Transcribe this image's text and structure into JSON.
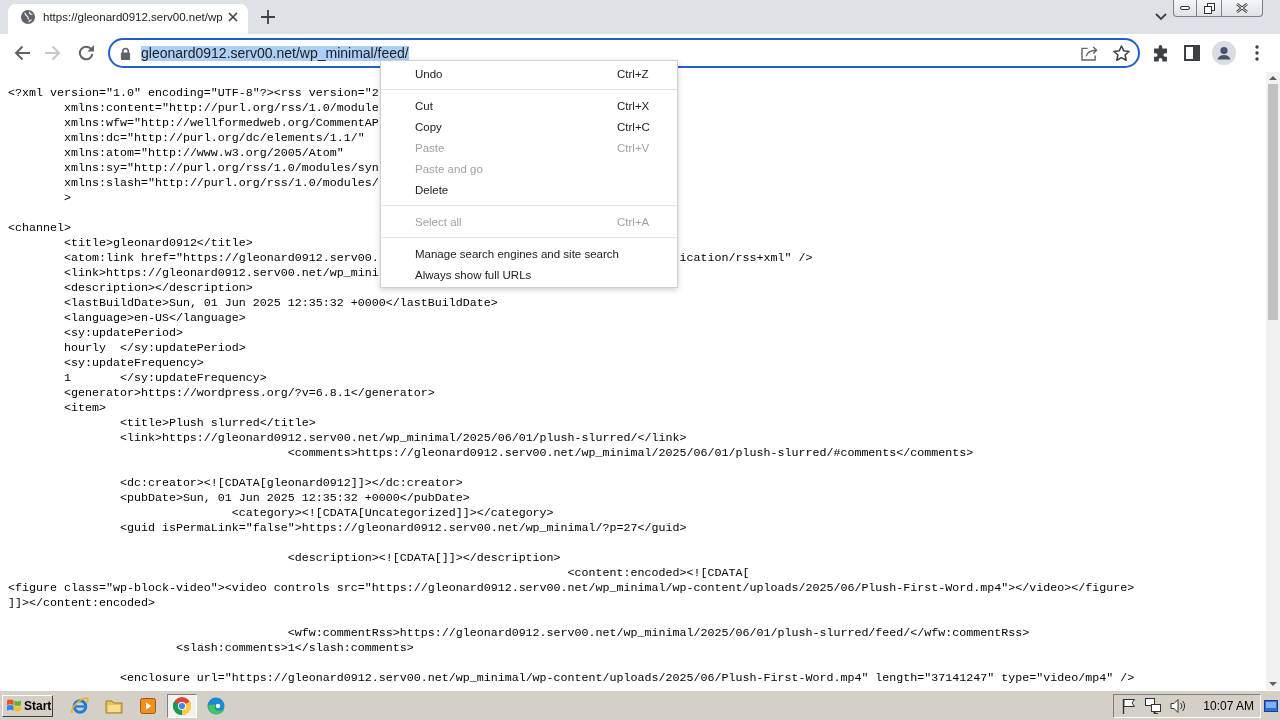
{
  "browser": {
    "tabs": [
      {
        "title": "https://gleonard0912.serv00.net/wp",
        "selected": true
      }
    ],
    "nav_buttons": [
      {
        "kind": "back",
        "disabled": false
      },
      {
        "kind": "forward",
        "disabled": true
      },
      {
        "kind": "reload",
        "disabled": false
      }
    ],
    "address_bar": {
      "url": "gleonard0912.serv00.net/wp_minimal/feed/",
      "selected": true
    }
  },
  "page": {
    "lines": [
      {
        "kind": "code",
        "text": "<?xml version=\"1.0\" encoding=\"UTF-8\"?><rss version=\"2"
      },
      {
        "kind": "code",
        "text": "\txmlns:content=\"http://purl.org/rss/1.0/module"
      },
      {
        "kind": "code",
        "text": "\txmlns:wfw=\"http://wellformedweb.org/CommentAP"
      },
      {
        "kind": "code",
        "text": "\txmlns:dc=\"http://purl.org/dc/elements/1.1/\""
      },
      {
        "kind": "code",
        "text": "\txmlns:atom=\"http://www.w3.org/2005/Atom\""
      },
      {
        "kind": "code",
        "text": "\txmlns:sy=\"http://purl.org/rss/1.0/modules/syn"
      },
      {
        "kind": "code",
        "text": "\txmlns:slash=\"http://purl.org/rss/1.0/modules/"
      },
      {
        "kind": "code",
        "text": "\t>"
      },
      {
        "kind": "blank"
      },
      {
        "kind": "code",
        "text": "<channel>"
      },
      {
        "kind": "code",
        "text": "\t<title>gleonard0912</title>"
      },
      {
        "kind": "code",
        "text": "\t<atom:link href=\"https://gleonard0912.serv00.",
        "text_after_menu": "ication/rss+xml\" />"
      },
      {
        "kind": "code",
        "text": "\t<link>https://gleonard0912.serv00.net/wp_mini"
      },
      {
        "kind": "code",
        "text": "\t<description></description>"
      },
      {
        "kind": "code",
        "text": "\t<lastBuildDate>Sun, 01 Jun 2025 12:35:32 +0000</lastBuildDate>"
      },
      {
        "kind": "code",
        "text": "\t<language>en-US</language>"
      },
      {
        "kind": "code",
        "text": "\t<sy:updatePeriod>"
      },
      {
        "kind": "code",
        "text": "\thourly\t</sy:updatePeriod>"
      },
      {
        "kind": "code",
        "text": "\t<sy:updateFrequency>"
      },
      {
        "kind": "code",
        "text": "\t1\t</sy:updateFrequency>"
      },
      {
        "kind": "code",
        "text": "\t<generator>https://wordpress.org/?v=6.8.1</generator>"
      },
      {
        "kind": "code",
        "text": "\t<item>"
      },
      {
        "kind": "code",
        "text": "\t\t<title>Plush slurred</title>"
      },
      {
        "kind": "code",
        "text": "\t\t<link>https://gleonard0912.serv00.net/wp_minimal/2025/06/01/plush-slurred/</link>"
      },
      {
        "kind": "code",
        "text": "\t\t\t\t\t<comments>https://gleonard0912.serv00.net/wp_minimal/2025/06/01/plush-slurred/#comments</comments>"
      },
      {
        "kind": "blank"
      },
      {
        "kind": "code",
        "text": "\t\t<dc:creator><![CDATA[gleonard0912]]></dc:creator>"
      },
      {
        "kind": "code",
        "text": "\t\t<pubDate>Sun, 01 Jun 2025 12:35:32 +0000</pubDate>"
      },
      {
        "kind": "code",
        "text": "\t\t\t\t<category><![CDATA[Uncategorized]]></category>"
      },
      {
        "kind": "code",
        "text": "\t\t<guid isPermaLink=\"false\">https://gleonard0912.serv00.net/wp_minimal/?p=27</guid>"
      },
      {
        "kind": "blank"
      },
      {
        "kind": "code",
        "text": "\t\t\t\t\t<description><![CDATA[]]></description>"
      },
      {
        "kind": "code",
        "text": "\t\t\t\t\t\t\t\t\t\t<content:encoded><![CDATA["
      },
      {
        "kind": "code",
        "text": "<figure class=\"wp-block-video\"><video controls src=\"https://gleonard0912.serv00.net/wp_minimal/wp-content/uploads/2025/06/Plush-First-Word.mp4\"></video></figure>"
      },
      {
        "kind": "code",
        "text": "]]></content:encoded>"
      },
      {
        "kind": "blank"
      },
      {
        "kind": "code",
        "text": "\t\t\t\t\t<wfw:commentRss>https://gleonard0912.serv00.net/wp_minimal/2025/06/01/plush-slurred/feed/</wfw:commentRss>"
      },
      {
        "kind": "code",
        "text": "\t\t\t<slash:comments>1</slash:comments>"
      },
      {
        "kind": "blank"
      },
      {
        "kind": "code",
        "text": "\t\t<enclosure url=\"https://gleonard0912.serv00.net/wp_minimal/wp-content/uploads/2025/06/Plush-First-Word.mp4\" length=\"37141247\" type=\"video/mp4\" />"
      }
    ]
  },
  "context_menu": {
    "items": [
      {
        "kind": "item",
        "label": "Undo",
        "shortcut": "Ctrl+Z",
        "disabled": false
      },
      {
        "kind": "separator"
      },
      {
        "kind": "item",
        "label": "Cut",
        "shortcut": "Ctrl+X",
        "disabled": false
      },
      {
        "kind": "item",
        "label": "Copy",
        "shortcut": "Ctrl+C",
        "disabled": false
      },
      {
        "kind": "item",
        "label": "Paste",
        "shortcut": "Ctrl+V",
        "disabled": true
      },
      {
        "kind": "item",
        "label": "Paste and go",
        "disabled": true
      },
      {
        "kind": "item",
        "label": "Delete",
        "disabled": false
      },
      {
        "kind": "separator"
      },
      {
        "kind": "item",
        "label": "Select all",
        "shortcut": "Ctrl+A",
        "disabled": true
      },
      {
        "kind": "separator"
      },
      {
        "kind": "item",
        "label": "Manage search engines and site search",
        "disabled": false
      },
      {
        "kind": "item",
        "label": "Always show full URLs",
        "disabled": false
      }
    ]
  },
  "taskbar": {
    "start_label": "Start",
    "apps": [
      {
        "kind": "ie",
        "active": false
      },
      {
        "kind": "folder",
        "active": false
      },
      {
        "kind": "media",
        "active": false
      },
      {
        "kind": "chrome",
        "active": true
      },
      {
        "kind": "edge",
        "active": false
      }
    ],
    "clock": "10:07 AM"
  }
}
